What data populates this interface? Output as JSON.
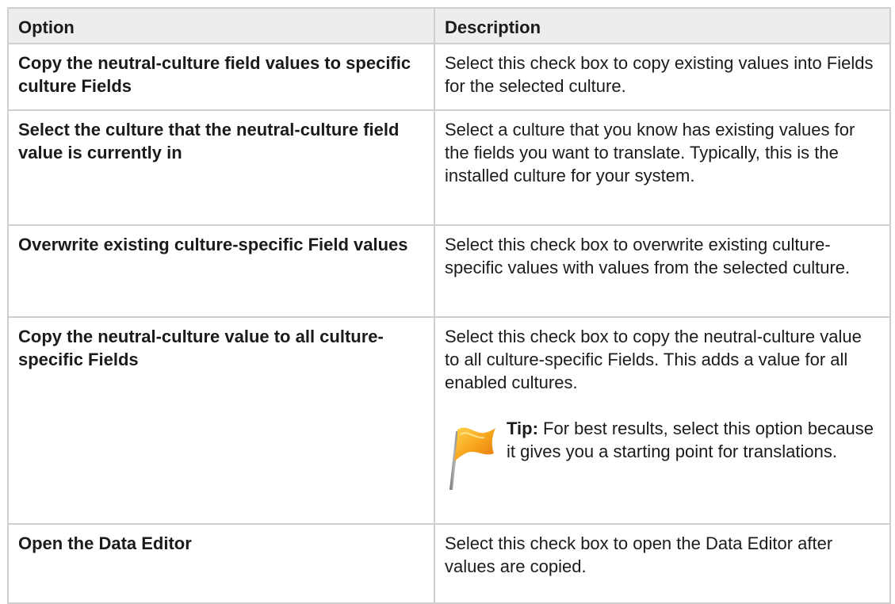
{
  "table": {
    "headers": {
      "option": "Option",
      "description": "Description"
    },
    "rows": [
      {
        "option": "Copy the neutral-culture field values to specific culture Fields",
        "description": "Select this check box to copy existing values into Fields for the selected culture."
      },
      {
        "option": "Select the culture that the neutral-culture field value is currently in",
        "description": "Select a culture that you know has existing values for the fields you want to translate. Typically, this is the installed culture for your system."
      },
      {
        "option": "Overwrite existing culture-specific Field values",
        "description": "Select this check box to overwrite existing culture-specific values with values from the selected culture."
      },
      {
        "option": "Copy the neutral-culture value to all culture-specific Fields",
        "description": "Select this check box to copy the neutral-culture value to all culture-specific Fields. This adds a value for all enabled cultures.",
        "tip": {
          "icon": "flag-icon",
          "label": "Tip:",
          "text": " For best results, select this option because it gives you a starting point for translations."
        }
      },
      {
        "option": "Open the Data Editor",
        "description": "Select this check box to open the Data Editor after values are copied."
      }
    ]
  },
  "colors": {
    "header_bg": "#ededed",
    "border": "#cfcfcf",
    "text": "#1b1b1b",
    "flag_orange": "#f7a21b",
    "flag_pole": "#8c8c8c"
  }
}
